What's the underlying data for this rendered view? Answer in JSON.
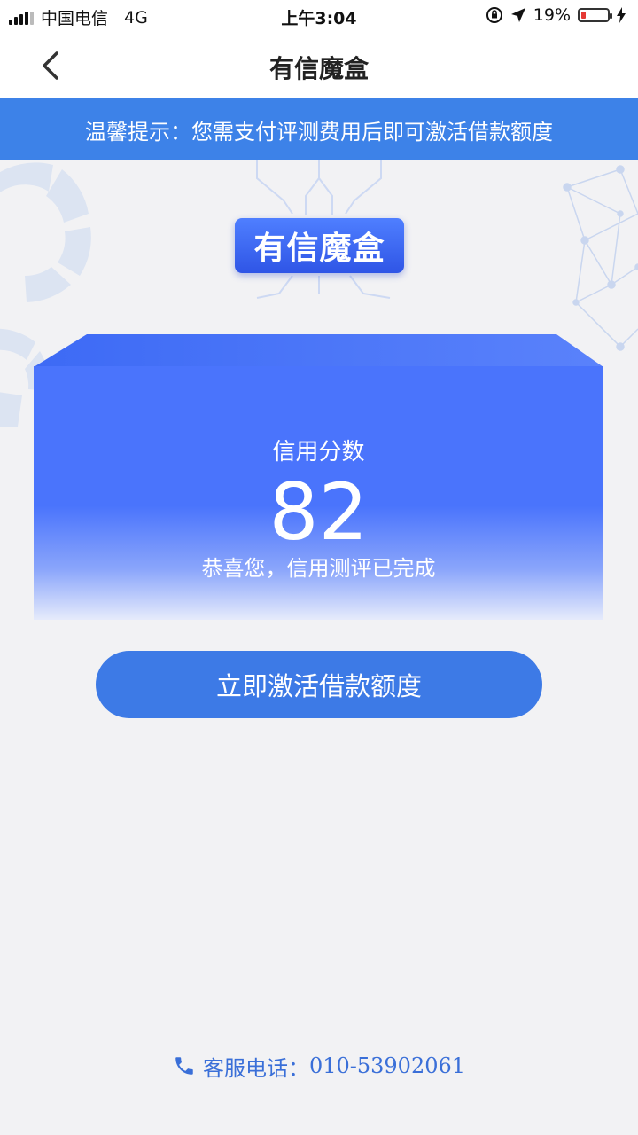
{
  "status_bar": {
    "carrier": "中国电信",
    "network": "4G",
    "time": "上午3:04",
    "battery_percent": "19%",
    "battery_level": 0.19,
    "icons": [
      "orientation-lock-icon",
      "location-arrow-icon",
      "charging-bolt-icon"
    ]
  },
  "nav": {
    "title": "有信魔盒",
    "back_icon": "chevron-left-icon"
  },
  "notice": {
    "text": "温馨提示：您需支付评测费用后即可激活借款额度"
  },
  "logo": {
    "text": "有信魔盒"
  },
  "score_card": {
    "label": "信用分数",
    "score": "82",
    "message": "恭喜您，信用测评已完成"
  },
  "actions": {
    "activate_label": "立即激活借款额度"
  },
  "footer": {
    "label": "客服电话：",
    "phone": "010-53902061",
    "icon": "phone-icon"
  },
  "colors": {
    "accent": "#3d82e8",
    "card": "#4a74fc",
    "button": "#3d7ae6",
    "footer_text": "#3a6fd8",
    "battery_low": "#e53935"
  }
}
